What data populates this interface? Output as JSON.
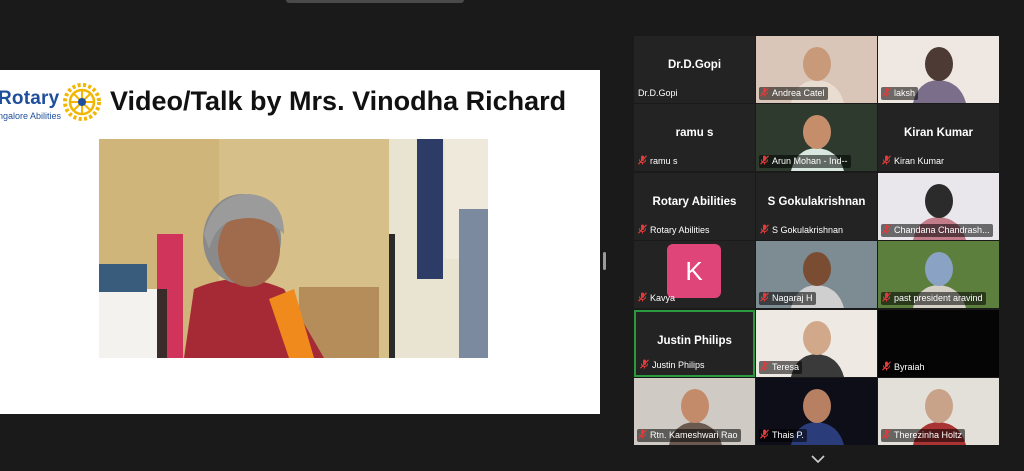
{
  "slide": {
    "logo_text": "Rotary",
    "logo_sub": "ngalore Abilities",
    "title": "Video/Talk by Mrs. Vinodha Richard"
  },
  "colors": {
    "background": "#1a1a1a",
    "tile": "#232323",
    "active_speaker_border": "#2a9a3f",
    "mute_icon": "#e03b3b",
    "avatar_k": "#e0457a",
    "rotary_blue": "#1f4e9c"
  },
  "participants": [
    {
      "display": "Dr.D.Gopi",
      "label": "Dr.D.Gopi",
      "video": false,
      "muted": false
    },
    {
      "display": "",
      "label": "Andrea Catel",
      "video": true,
      "muted": true
    },
    {
      "display": "",
      "label": "laksh",
      "video": true,
      "muted": true
    },
    {
      "display": "ramu s",
      "label": "ramu s",
      "video": false,
      "muted": true
    },
    {
      "display": "",
      "label": "Arun Mohan - Ind--",
      "video": true,
      "muted": true
    },
    {
      "display": "Kiran Kumar",
      "label": "Kiran Kumar",
      "video": false,
      "muted": true
    },
    {
      "display": "Rotary Abilities",
      "label": "Rotary Abilities",
      "video": false,
      "muted": true
    },
    {
      "display": "S Gokulakrishnan",
      "label": "S Gokulakrishnan",
      "video": false,
      "muted": true
    },
    {
      "display": "",
      "label": "Chandana Chandrash...",
      "video": true,
      "muted": true
    },
    {
      "display": "",
      "label": "Kavya",
      "avatar_letter": "K",
      "video": false,
      "muted": true
    },
    {
      "display": "",
      "label": "Nagaraj H",
      "video": true,
      "muted": true
    },
    {
      "display": "",
      "label": "past president aravind",
      "video": true,
      "muted": true
    },
    {
      "display": "Justin Philips",
      "label": "Justin Philips",
      "video": false,
      "muted": true,
      "active": true
    },
    {
      "display": "",
      "label": "Teresa",
      "video": true,
      "muted": true
    },
    {
      "display": "",
      "label": "Byraiah",
      "video": true,
      "muted": true
    },
    {
      "display": "",
      "label": "Rtn. Kameshwari Rao",
      "video": true,
      "muted": true
    },
    {
      "display": "",
      "label": "Thais P.",
      "video": true,
      "muted": true
    },
    {
      "display": "",
      "label": "Therezinha Holtz",
      "video": true,
      "muted": true
    }
  ],
  "icons": {
    "mute": "mic-muted-icon",
    "pager": "chevron-down-icon",
    "logo": "rotary-wheel-icon"
  }
}
